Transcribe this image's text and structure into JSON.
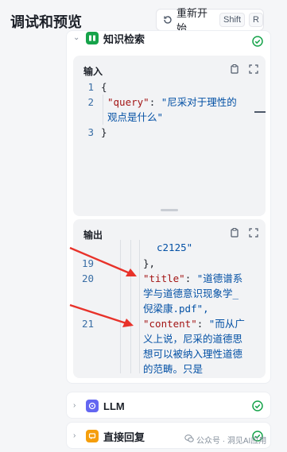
{
  "header": {
    "title": "调试和预览",
    "restart_label": "重新开始",
    "key_shift": "Shift",
    "key_r": "R"
  },
  "nodes": {
    "knowledge": {
      "title": "知识检索",
      "icon": "knowledge-icon",
      "status": "success",
      "color": "#16a34a"
    },
    "llm": {
      "title": "LLM",
      "icon": "llm-icon",
      "status": "success",
      "color": "#6366f1"
    },
    "reply": {
      "title": "直接回复",
      "icon": "reply-icon",
      "status": "success",
      "color": "#f59e0b"
    }
  },
  "input": {
    "label": "输入",
    "lines": [
      {
        "no": "1",
        "text": "{"
      },
      {
        "no": "2",
        "key": "\"query\"",
        "colon": ": ",
        "value": "\"尼采对于理性的观点是什么\""
      },
      {
        "no": "3",
        "text": "}"
      }
    ]
  },
  "output": {
    "label": "输出",
    "top_fragment": "c2125\"",
    "line19": {
      "no": "19",
      "text": "},"
    },
    "line20": {
      "no": "20",
      "key": "\"title\"",
      "colon": ": ",
      "value": "\"道德谱系学与道德意识现象学_倪梁康.pdf\","
    },
    "line21": {
      "no": "21",
      "key": "\"content\"",
      "colon": ": ",
      "value": "\"而从广义上说，尼采的道德思想可以被纳入理性道德的范畴。只是"
    }
  },
  "watermark": "公众号 · 洞见AI应用"
}
